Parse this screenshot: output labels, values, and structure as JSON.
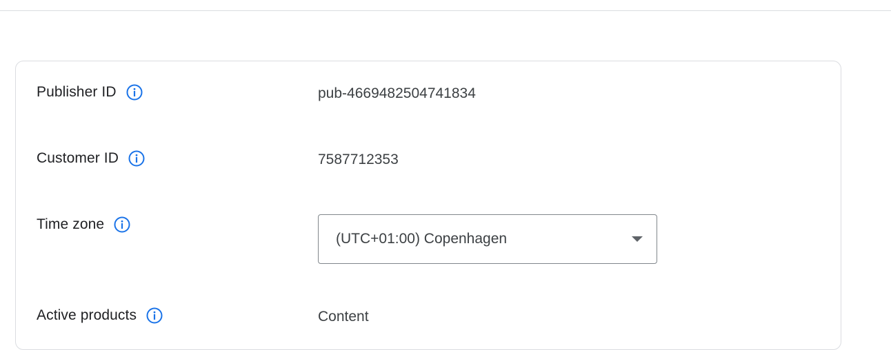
{
  "settings": {
    "rows": [
      {
        "label": "Publisher ID",
        "value": "pub-4669482504741834",
        "info_icon": "info-icon"
      },
      {
        "label": "Customer ID",
        "value": "7587712353",
        "info_icon": "info-icon"
      },
      {
        "label": "Time zone",
        "value": "(UTC+01:00) Copenhagen",
        "info_icon": "info-icon",
        "control": "dropdown"
      },
      {
        "label": "Active products",
        "value": "Content",
        "info_icon": "info-icon"
      }
    ]
  },
  "colors": {
    "info_icon": "#1a73e8",
    "border": "#dadce0",
    "text": "#202124"
  }
}
